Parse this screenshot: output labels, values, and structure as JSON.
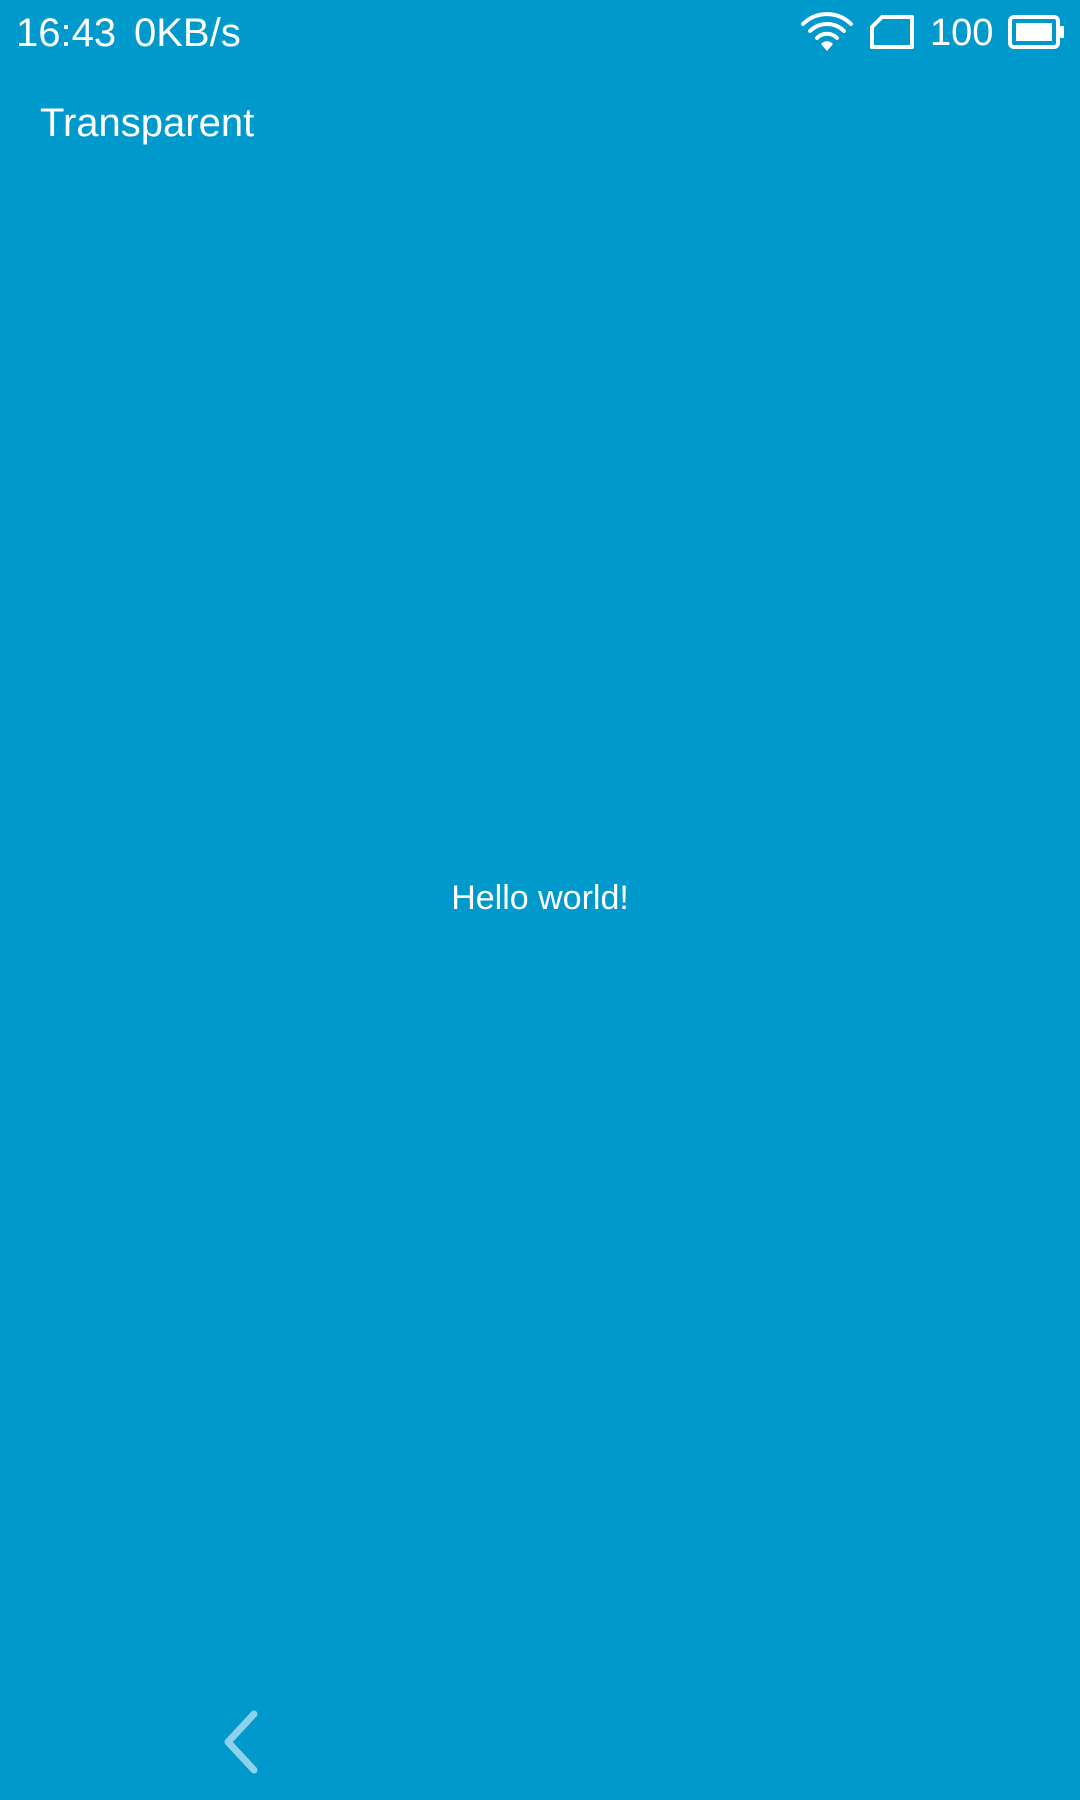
{
  "status_bar": {
    "time": "16:43",
    "network_speed": "0KB/s",
    "battery_level": "100",
    "icons": [
      "wifi-icon",
      "sim-card-icon",
      "battery-icon"
    ]
  },
  "app_bar": {
    "title": "Transparent"
  },
  "content": {
    "message": "Hello world!"
  },
  "nav_bar": {
    "icons": [
      "back-chevron-icon"
    ]
  },
  "colors": {
    "background": "#0099cc",
    "text": "#ffffff",
    "nav_icon": "#8fd0ea"
  }
}
